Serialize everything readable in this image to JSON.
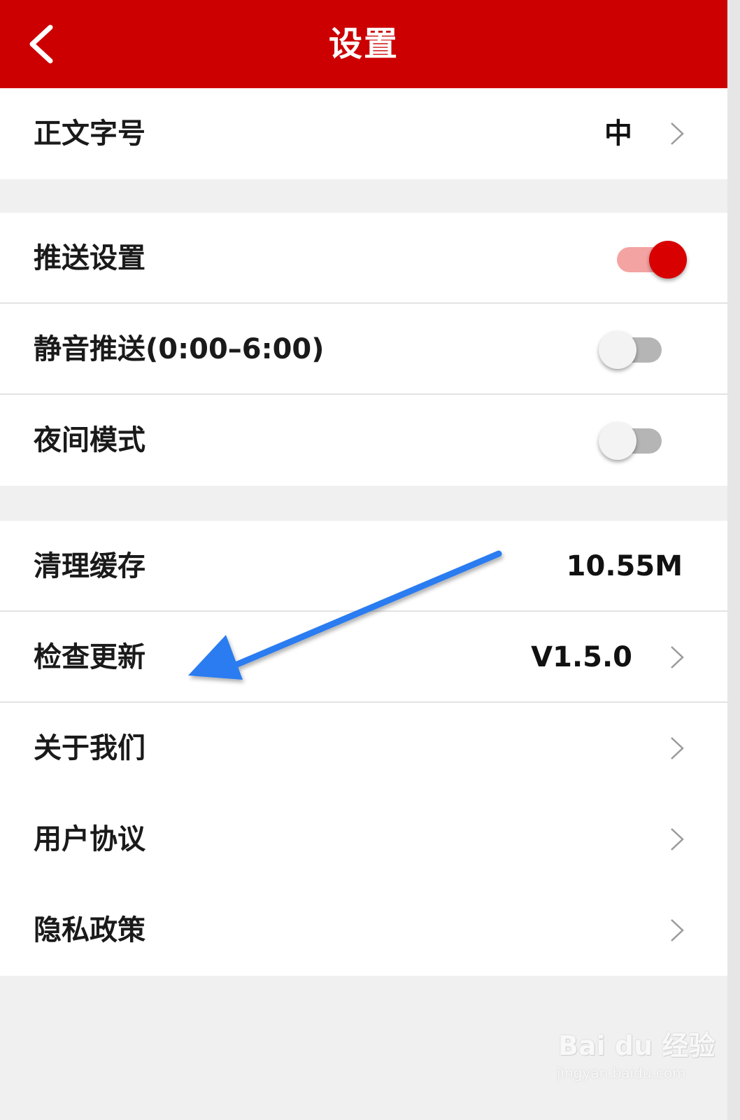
{
  "header": {
    "title": "设置",
    "back_icon": "chevron-left-icon",
    "background": "#cc0000"
  },
  "settings": {
    "font_size": {
      "label": "正文字号",
      "value": "中"
    },
    "push": {
      "label": "推送设置",
      "enabled": true
    },
    "mute_push": {
      "label": "静音推送(0:00–6:00)",
      "enabled": false
    },
    "night_mode": {
      "label": "夜间模式",
      "enabled": false
    },
    "clear_cache": {
      "label": "清理缓存",
      "value": "10.55M"
    },
    "check_update": {
      "label": "检查更新",
      "value": "V1.5.0"
    },
    "about_us": {
      "label": "关于我们"
    },
    "user_agreement": {
      "label": "用户协议"
    },
    "privacy_policy": {
      "label": "隐私政策"
    }
  },
  "annotation": {
    "arrow_color": "#2a7bf0"
  },
  "watermark": {
    "brand": "Bai du 经验",
    "url": "jingyan.baidu.com"
  },
  "colors": {
    "accent": "#cc0000",
    "toggle_on": "#d80000",
    "toggle_off": "#b5b5b5"
  }
}
